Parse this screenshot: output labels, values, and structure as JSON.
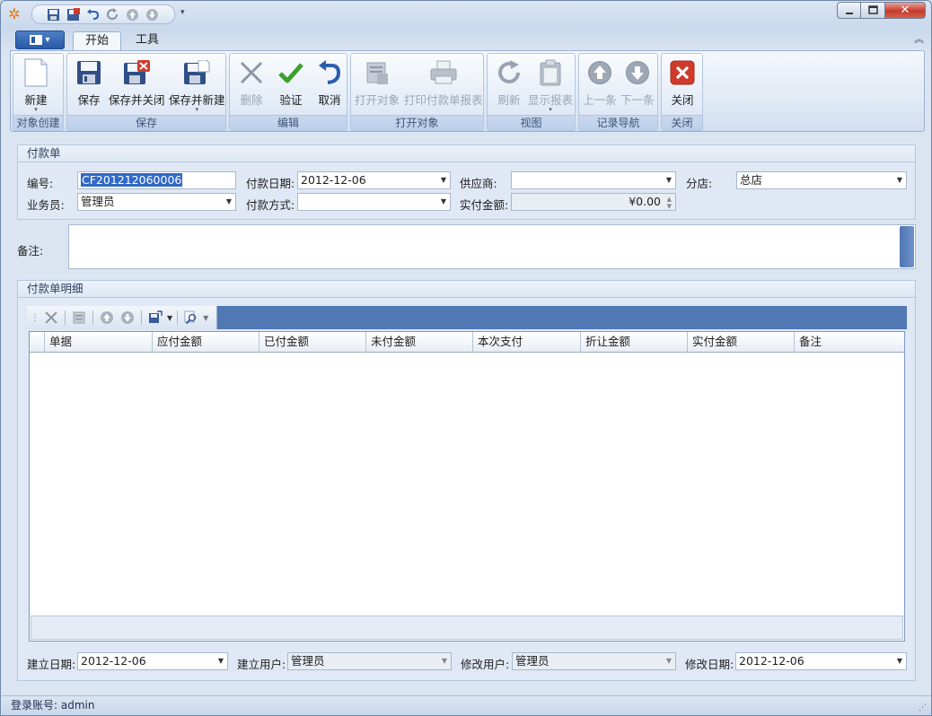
{
  "ribbon": {
    "tabs": [
      {
        "label": "开始"
      },
      {
        "label": "工具"
      }
    ],
    "groups": [
      {
        "label": "对象创建",
        "buttons": [
          {
            "label": "新建"
          }
        ]
      },
      {
        "label": "保存",
        "buttons": [
          {
            "label": "保存"
          },
          {
            "label": "保存并关闭"
          },
          {
            "label": "保存并新建"
          }
        ]
      },
      {
        "label": "编辑",
        "buttons": [
          {
            "label": "删除"
          },
          {
            "label": "验证"
          },
          {
            "label": "取消"
          }
        ]
      },
      {
        "label": "打开对象",
        "buttons": [
          {
            "label": "打开对象"
          },
          {
            "label": "打印付款单报表"
          }
        ]
      },
      {
        "label": "视图",
        "buttons": [
          {
            "label": "刷新"
          },
          {
            "label": "显示报表"
          }
        ]
      },
      {
        "label": "记录导航",
        "buttons": [
          {
            "label": "上一条"
          },
          {
            "label": "下一条"
          }
        ]
      },
      {
        "label": "关闭",
        "buttons": [
          {
            "label": "关闭"
          }
        ]
      }
    ]
  },
  "form": {
    "title": "付款单",
    "code_label": "编号:",
    "code_value": "CF201212060006",
    "paydate_label": "付款日期:",
    "paydate_value": "2012-12-06",
    "supplier_label": "供应商:",
    "supplier_value": "",
    "branch_label": "分店:",
    "branch_value": "总店",
    "clerk_label": "业务员:",
    "clerk_value": "管理员",
    "paymethod_label": "付款方式:",
    "paymethod_value": "",
    "amount_label": "实付金额:",
    "amount_value": "¥0.00",
    "remark_label": "备注:",
    "remark_value": ""
  },
  "detail": {
    "title": "付款单明细",
    "columns": [
      "单据",
      "应付金额",
      "已付金额",
      "未付金额",
      "本次支付",
      "折让金额",
      "实付金额",
      "备注"
    ]
  },
  "footer": {
    "created_date_label": "建立日期:",
    "created_date_value": "2012-12-06",
    "created_user_label": "建立用户:",
    "created_user_value": "管理员",
    "modified_user_label": "修改用户:",
    "modified_user_value": "管理员",
    "modified_date_label": "修改日期:",
    "modified_date_value": "2012-12-06"
  },
  "status": {
    "text": "登录账号: admin"
  },
  "colors": {
    "accent": "#5079b3",
    "selection": "#3169c6",
    "close_red": "#d03a2b",
    "check_green": "#3aa12e"
  }
}
